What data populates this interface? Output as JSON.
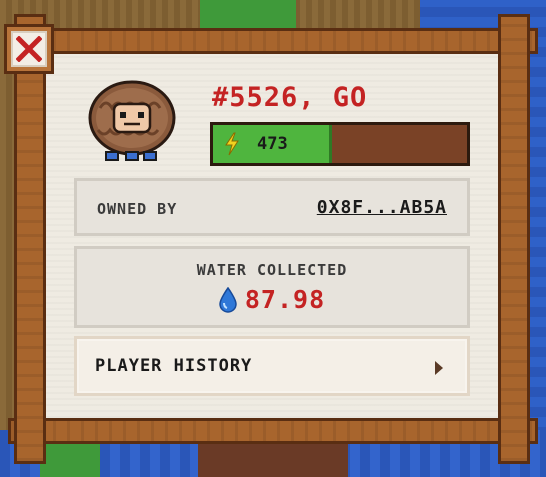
{
  "character": {
    "title": "#5526, GO",
    "energy": {
      "value": "473",
      "fill_fraction": 0.47,
      "colors": {
        "fill": "#4fb53e",
        "empty": "#7a4226",
        "bolt": "#f2d21f"
      }
    }
  },
  "ownership": {
    "label": "OWNED BY",
    "address": "0X8F...AB5A"
  },
  "water": {
    "label": "WATER COLLECTED",
    "value": "87.98",
    "icon": "water-drop-icon",
    "color": "#c42323"
  },
  "history": {
    "label": "PLAYER HISTORY",
    "icon": "chevron-right-icon"
  },
  "close": {
    "icon": "close-icon",
    "color": "#c42323"
  }
}
